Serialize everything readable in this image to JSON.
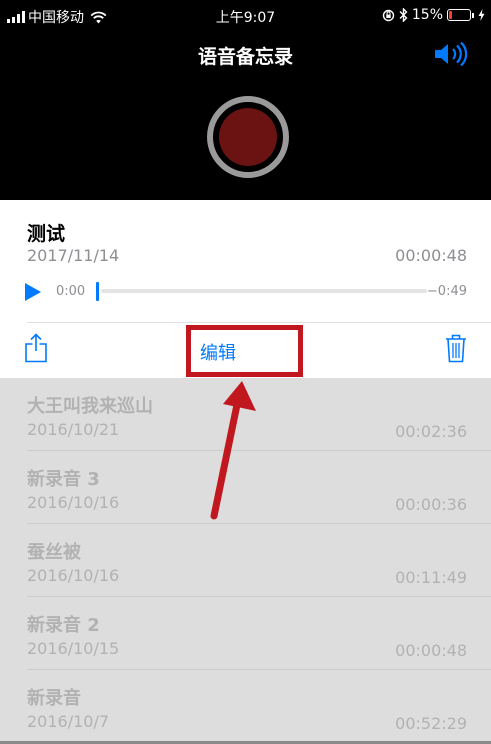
{
  "status_bar": {
    "carrier": "中国移动",
    "time": "上午9:07",
    "battery_percent": "15%",
    "battery_level": 0.15,
    "battery_color": "#ff3b30",
    "icons": [
      "signal-icon",
      "wifi-icon",
      "orientation-lock-icon",
      "bluetooth-icon",
      "battery-icon",
      "charging-icon"
    ]
  },
  "header": {
    "title": "语音备忘录",
    "speaker_icon": "speaker-icon",
    "record_button_icon": "record-icon"
  },
  "selected_recording": {
    "name": "测试",
    "date": "2017/11/14",
    "duration": "00:00:48",
    "position": "0:00",
    "remaining": "−0:49",
    "progress": 0,
    "accent_color": "#007aff"
  },
  "actions": {
    "share_icon": "share-icon",
    "edit_label": "编辑",
    "trash_icon": "trash-icon",
    "annotation_color": "#c1181f"
  },
  "recordings": [
    {
      "name": "大王叫我来巡山",
      "date": "2016/10/21",
      "duration": "00:02:36"
    },
    {
      "name": "新录音 3",
      "date": "2016/10/16",
      "duration": "00:00:36"
    },
    {
      "name": "蚕丝被",
      "date": "2016/10/16",
      "duration": "00:11:49"
    },
    {
      "name": "新录音 2",
      "date": "2016/10/15",
      "duration": "00:00:48"
    },
    {
      "name": "新录音",
      "date": "2016/10/7",
      "duration": "00:52:29"
    }
  ]
}
